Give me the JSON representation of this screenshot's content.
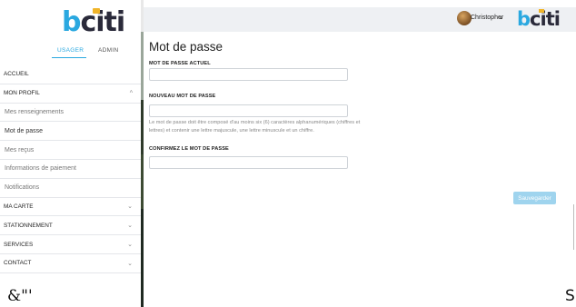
{
  "brand": {
    "logo_text_main": "b",
    "logo_text_rest": "citi"
  },
  "sidebar": {
    "tabs": [
      {
        "label": "USAGER",
        "active": true
      },
      {
        "label": "ADMIN",
        "active": false
      }
    ],
    "items": [
      {
        "label": "ACCUEIL",
        "type": "section"
      },
      {
        "label": "MON PROFIL",
        "type": "section",
        "chevron": "^"
      },
      {
        "label": "Mes renseignements",
        "type": "sub"
      },
      {
        "label": "Mot de passe",
        "type": "sub"
      },
      {
        "label": "Mes reçus",
        "type": "sub"
      },
      {
        "label": "Informations de paiement",
        "type": "sub"
      },
      {
        "label": "Notifications",
        "type": "sub"
      },
      {
        "label": "MA CARTE",
        "type": "section",
        "chevron": "⌄"
      },
      {
        "label": "STATIONNEMENT",
        "type": "section",
        "chevron": "⌄"
      },
      {
        "label": "SERVICES",
        "type": "section",
        "chevron": "⌄"
      },
      {
        "label": "CONTACT",
        "type": "section",
        "chevron": "⌄"
      }
    ],
    "footer_note": "&\"'"
  },
  "topbar": {
    "username": "Christopher",
    "user_chevron": "⌄"
  },
  "page": {
    "title": "Mot de passe",
    "current_label": "MOT DE PASSE ACTUEL",
    "current_value": "",
    "new_label": "NOUVEAU MOT DE PASSE",
    "new_value": "",
    "help_text": "Le mot de passe doit être composé d'au moins six (6) caractères alphanumériques (chiffres et lettres) et contenir une lettre majuscule, une lettre minuscule et un chiffre.",
    "confirm_label": "CONFIRMEZ LE MOT DE PASSE",
    "confirm_value": "",
    "save_label": "Sauvegarder"
  },
  "edge_text": "S",
  "colors": {
    "accent": "#2aa8e0",
    "button": "#9fd4ee",
    "logo_yellow": "#f0b429"
  }
}
